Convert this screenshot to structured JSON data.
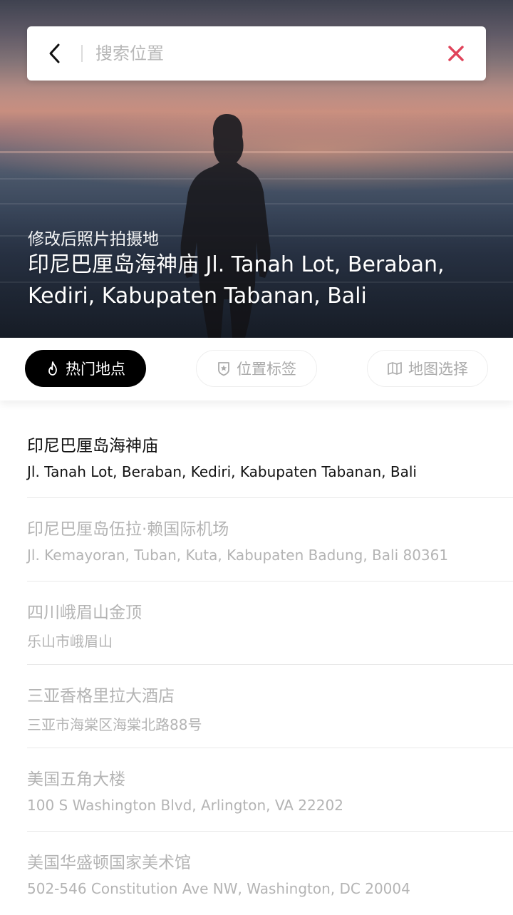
{
  "search": {
    "placeholder": "搜索位置",
    "back_icon": "chevron-left-icon",
    "clear_icon": "close-icon",
    "clear_color": "#e0435a"
  },
  "hero": {
    "label": "修改后照片拍摄地",
    "title": "印尼巴厘岛海神庙 Jl. Tanah Lot, Beraban, Kediri, Kabupaten Tabanan, Bali"
  },
  "tabs": [
    {
      "label": "热门地点",
      "icon": "flame-icon",
      "active": true
    },
    {
      "label": "位置标签",
      "icon": "badge-star-icon",
      "active": false
    },
    {
      "label": "地图选择",
      "icon": "map-icon",
      "active": false
    }
  ],
  "locations": [
    {
      "name": "印尼巴厘岛海神庙",
      "address": "Jl. Tanah Lot, Beraban, Kediri, Kabupaten Tabanan, Bali",
      "selected": true
    },
    {
      "name": "印尼巴厘岛伍拉·赖国际机场",
      "address": "Jl. Kemayoran, Tuban, Kuta, Kabupaten Badung, Bali 80361",
      "selected": false
    },
    {
      "name": "四川峨眉山金顶",
      "address": "乐山市峨眉山",
      "selected": false
    },
    {
      "name": "三亚香格里拉大酒店",
      "address": "三亚市海棠区海棠北路88号",
      "selected": false
    },
    {
      "name": "美国五角大楼",
      "address": "100 S Washington Blvd, Arlington, VA 22202",
      "selected": false
    },
    {
      "name": "美国华盛顿国家美术馆",
      "address": "502-546 Constitution Ave NW, Washington, DC 20004",
      "selected": false
    }
  ],
  "colors": {
    "active_tab_bg": "#000000",
    "inactive_text": "#b4b4b4",
    "selected_text": "#111111"
  }
}
